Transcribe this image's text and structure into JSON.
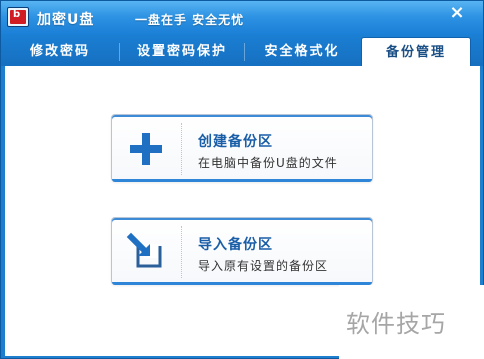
{
  "window": {
    "title": "加密U盘",
    "slogan": "一盘在手 安全无忧",
    "close_label": "×"
  },
  "tabs": [
    {
      "label": "修改密码",
      "active": false
    },
    {
      "label": "设置密码保护",
      "active": false
    },
    {
      "label": "安全格式化",
      "active": false
    },
    {
      "label": "备份管理",
      "active": true
    }
  ],
  "actions": {
    "create_backup": {
      "title": "创建备份区",
      "description": "在电脑中备份U盘的文件",
      "icon": "plus-icon"
    },
    "import_backup": {
      "title": "导入备份区",
      "description": "导入原有设置的备份区",
      "icon": "import-arrow-icon"
    }
  },
  "watermark": "软件技巧",
  "colors": {
    "titlebar": "#2e93e3",
    "tab_active_text": "#1a4f86",
    "card_title": "#1a5ea8",
    "accent": "#2f86d9"
  }
}
